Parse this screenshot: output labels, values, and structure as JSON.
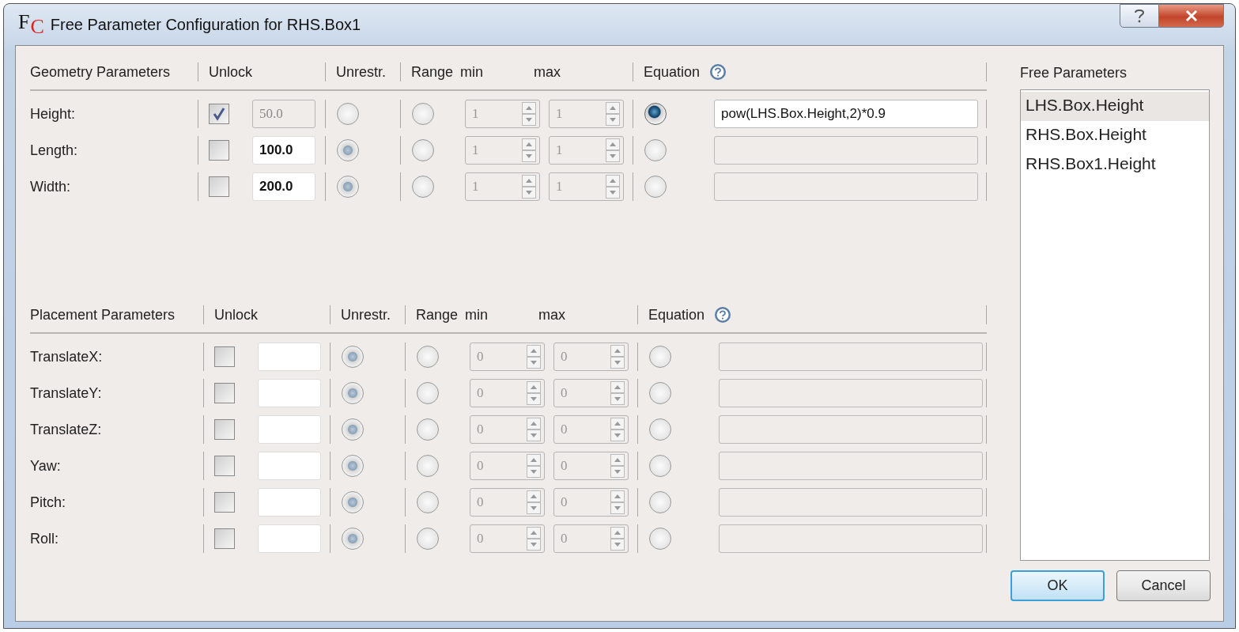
{
  "window": {
    "title": "Free Parameter Configuration for RHS.Box1",
    "icon_letters": "FC"
  },
  "sections": [
    {
      "title": "Geometry Parameters",
      "columns": {
        "unlock": "Unlock",
        "unrestricted": "Unrestr.",
        "range": "Range",
        "min": "min",
        "max": "max",
        "equation": "Equation"
      },
      "rows": [
        {
          "label": "Height:",
          "unlocked": true,
          "value": "50.0",
          "unrestricted_selected": false,
          "range_selected": false,
          "equation_selected": true,
          "min": "1",
          "max": "1",
          "equation": "pow(LHS.Box.Height,2)*0.9"
        },
        {
          "label": "Length:",
          "unlocked": false,
          "value": "100.0",
          "unrestricted_selected": true,
          "range_selected": false,
          "equation_selected": false,
          "min": "1",
          "max": "1"
        },
        {
          "label": "Width:",
          "unlocked": false,
          "value": "200.0",
          "unrestricted_selected": true,
          "range_selected": false,
          "equation_selected": false,
          "min": "1",
          "max": "1"
        }
      ]
    },
    {
      "title": "Placement Parameters",
      "columns": {
        "unlock": "Unlock",
        "unrestricted": "Unrestr.",
        "range": "Range",
        "min": "min",
        "max": "max",
        "equation": "Equation"
      },
      "rows": [
        {
          "label": "TranslateX:",
          "unlocked": false,
          "unrestricted_selected": true,
          "range_selected": false,
          "equation_selected": false,
          "min": "0",
          "max": "0"
        },
        {
          "label": "TranslateY:",
          "unlocked": false,
          "unrestricted_selected": true,
          "range_selected": false,
          "equation_selected": false,
          "min": "0",
          "max": "0"
        },
        {
          "label": "TranslateZ:",
          "unlocked": false,
          "unrestricted_selected": true,
          "range_selected": false,
          "equation_selected": false,
          "min": "0",
          "max": "0"
        },
        {
          "label": "Yaw:",
          "unlocked": false,
          "unrestricted_selected": true,
          "range_selected": false,
          "equation_selected": false,
          "min": "0",
          "max": "0"
        },
        {
          "label": "Pitch:",
          "unlocked": false,
          "unrestricted_selected": true,
          "range_selected": false,
          "equation_selected": false,
          "min": "0",
          "max": "0"
        },
        {
          "label": "Roll:",
          "unlocked": false,
          "unrestricted_selected": true,
          "range_selected": false,
          "equation_selected": false,
          "min": "0",
          "max": "0"
        }
      ]
    }
  ],
  "free_parameters": {
    "title": "Free Parameters",
    "items": [
      {
        "label": "LHS.Box.Height",
        "selected": true
      },
      {
        "label": "RHS.Box.Height",
        "selected": false
      },
      {
        "label": "RHS.Box1.Height",
        "selected": false
      }
    ]
  },
  "buttons": [
    {
      "label": "OK",
      "default": true
    },
    {
      "label": "Cancel",
      "default": false
    }
  ]
}
